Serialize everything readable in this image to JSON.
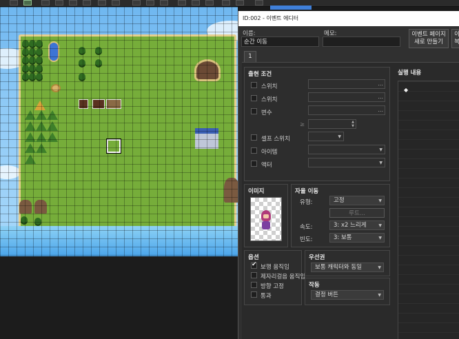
{
  "dialog": {
    "title": "ID:002 - 이벤트 에디터",
    "name_label": "이름:",
    "name_value": "순간 이동",
    "memo_label": "메모:",
    "memo_value": "",
    "new_page_button": "이벤트 페이지\n새로 만들기",
    "copy_page_button_partial": "이\n복",
    "page_tab": "1"
  },
  "conditions": {
    "title": "출현 조건",
    "switch1": "스위치",
    "switch2": "스위치",
    "variable": "변수",
    "self_switch": "셀프 스위치",
    "item": "아이템",
    "actor": "액터",
    "more": "..."
  },
  "image": {
    "title": "이미지"
  },
  "autonomous_movement": {
    "title": "자율 이동",
    "type_label": "유형:",
    "type_value": "고정",
    "route_button": "루트...",
    "speed_label": "속도:",
    "speed_value": "3: x2 느리게",
    "freq_label": "빈도:",
    "freq_value": "3: 보통"
  },
  "options": {
    "title": "옵션",
    "items": [
      {
        "label": "보행 움직임",
        "checked": true
      },
      {
        "label": "제자리걸음 움직임",
        "checked": false
      },
      {
        "label": "방향 고정",
        "checked": false
      },
      {
        "label": "통과",
        "checked": false
      }
    ]
  },
  "priority": {
    "title": "우선권",
    "value": "보통 캐릭터와 동일"
  },
  "trigger": {
    "title": "작동",
    "value": "결정 버튼"
  },
  "contents": {
    "title": "실행 내용",
    "marker": "◆"
  },
  "colors": {
    "map_land": "#76ad3a",
    "map_sea": "#6fb7f0",
    "dialog_bg": "#303030",
    "titlebar": "#ffffff"
  }
}
